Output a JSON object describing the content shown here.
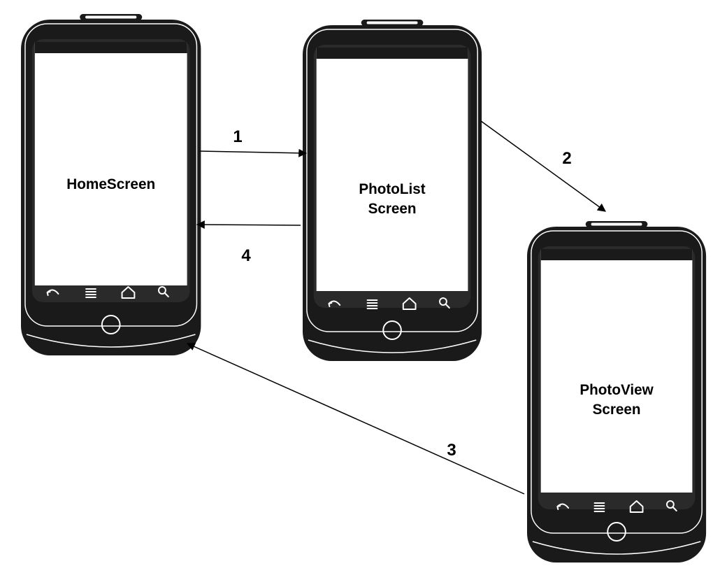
{
  "screens": {
    "home": {
      "label_lines": [
        "HomeScreen"
      ]
    },
    "photolist": {
      "label_lines": [
        "PhotoList",
        "Screen"
      ]
    },
    "photoview": {
      "label_lines": [
        "PhotoView",
        "Screen"
      ]
    }
  },
  "transitions": [
    {
      "label": "1",
      "from": "HomeScreen",
      "to": "PhotoList Screen"
    },
    {
      "label": "2",
      "from": "PhotoList Screen",
      "to": "PhotoView Screen"
    },
    {
      "label": "3",
      "from": "PhotoView Screen",
      "to": "HomeScreen"
    },
    {
      "label": "4",
      "from": "PhotoList Screen",
      "to": "HomeScreen"
    }
  ],
  "nav_buttons": [
    "back-icon",
    "menu-icon",
    "home-icon",
    "search-icon"
  ],
  "colors": {
    "device_body": "#1a1a1a",
    "screen": "#ffffff",
    "status_bar": "#1a1a1a",
    "line": "#000000"
  }
}
